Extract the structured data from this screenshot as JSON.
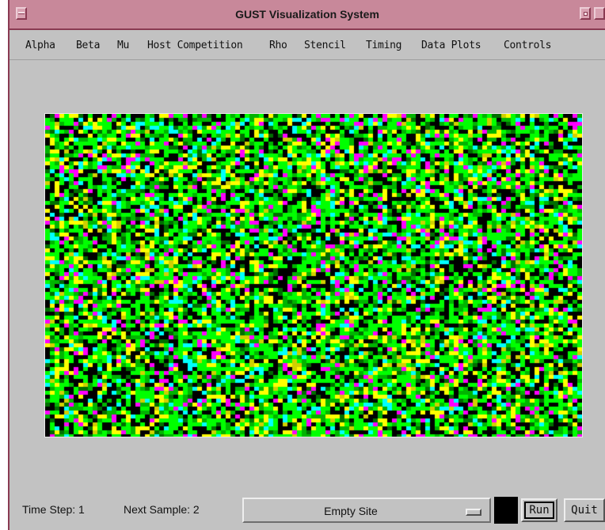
{
  "window": {
    "title": "GUST Visualization System"
  },
  "menu": {
    "items": [
      "Alpha",
      "Beta",
      "Mu",
      "Host Competition",
      "Rho",
      "Stencil",
      "Timing",
      "Data Plots",
      "Controls"
    ]
  },
  "grid": {
    "cell_colors": [
      "#000000",
      "#00ff00",
      "#00b400",
      "#006e00",
      "#ffff00",
      "#00ffff",
      "#ff00ff",
      "#d0d000"
    ],
    "background": "#000000"
  },
  "status": {
    "time_step": "Time Step: 1",
    "next_sample": "Next Sample: 2"
  },
  "site_select": {
    "value": "Empty Site"
  },
  "swatch": {
    "color": "#000000"
  },
  "buttons": {
    "run": "Run",
    "quit": "Quit"
  }
}
